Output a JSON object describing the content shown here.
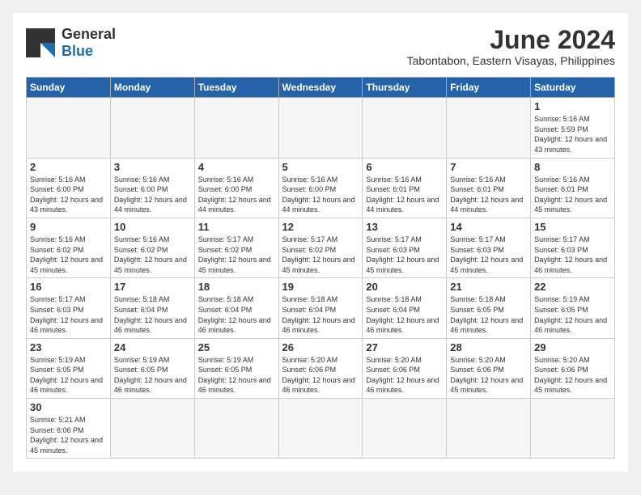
{
  "header": {
    "logo_general": "General",
    "logo_blue": "Blue",
    "month": "June 2024",
    "location": "Tabontabon, Eastern Visayas, Philippines"
  },
  "weekdays": [
    "Sunday",
    "Monday",
    "Tuesday",
    "Wednesday",
    "Thursday",
    "Friday",
    "Saturday"
  ],
  "weeks": [
    [
      {
        "day": "",
        "info": ""
      },
      {
        "day": "",
        "info": ""
      },
      {
        "day": "",
        "info": ""
      },
      {
        "day": "",
        "info": ""
      },
      {
        "day": "",
        "info": ""
      },
      {
        "day": "",
        "info": ""
      },
      {
        "day": "1",
        "info": "Sunrise: 5:16 AM\nSunset: 5:59 PM\nDaylight: 12 hours\nand 43 minutes."
      }
    ],
    [
      {
        "day": "2",
        "info": "Sunrise: 5:16 AM\nSunset: 6:00 PM\nDaylight: 12 hours\nand 43 minutes."
      },
      {
        "day": "3",
        "info": "Sunrise: 5:16 AM\nSunset: 6:00 PM\nDaylight: 12 hours\nand 44 minutes."
      },
      {
        "day": "4",
        "info": "Sunrise: 5:16 AM\nSunset: 6:00 PM\nDaylight: 12 hours\nand 44 minutes."
      },
      {
        "day": "5",
        "info": "Sunrise: 5:16 AM\nSunset: 6:00 PM\nDaylight: 12 hours\nand 44 minutes."
      },
      {
        "day": "6",
        "info": "Sunrise: 5:16 AM\nSunset: 6:01 PM\nDaylight: 12 hours\nand 44 minutes."
      },
      {
        "day": "7",
        "info": "Sunrise: 5:16 AM\nSunset: 6:01 PM\nDaylight: 12 hours\nand 44 minutes."
      },
      {
        "day": "8",
        "info": "Sunrise: 5:16 AM\nSunset: 6:01 PM\nDaylight: 12 hours\nand 45 minutes."
      }
    ],
    [
      {
        "day": "9",
        "info": "Sunrise: 5:16 AM\nSunset: 6:02 PM\nDaylight: 12 hours\nand 45 minutes."
      },
      {
        "day": "10",
        "info": "Sunrise: 5:16 AM\nSunset: 6:02 PM\nDaylight: 12 hours\nand 45 minutes."
      },
      {
        "day": "11",
        "info": "Sunrise: 5:17 AM\nSunset: 6:02 PM\nDaylight: 12 hours\nand 45 minutes."
      },
      {
        "day": "12",
        "info": "Sunrise: 5:17 AM\nSunset: 6:02 PM\nDaylight: 12 hours\nand 45 minutes."
      },
      {
        "day": "13",
        "info": "Sunrise: 5:17 AM\nSunset: 6:03 PM\nDaylight: 12 hours\nand 45 minutes."
      },
      {
        "day": "14",
        "info": "Sunrise: 5:17 AM\nSunset: 6:03 PM\nDaylight: 12 hours\nand 45 minutes."
      },
      {
        "day": "15",
        "info": "Sunrise: 5:17 AM\nSunset: 6:03 PM\nDaylight: 12 hours\nand 46 minutes."
      }
    ],
    [
      {
        "day": "16",
        "info": "Sunrise: 5:17 AM\nSunset: 6:03 PM\nDaylight: 12 hours\nand 46 minutes."
      },
      {
        "day": "17",
        "info": "Sunrise: 5:18 AM\nSunset: 6:04 PM\nDaylight: 12 hours\nand 46 minutes."
      },
      {
        "day": "18",
        "info": "Sunrise: 5:18 AM\nSunset: 6:04 PM\nDaylight: 12 hours\nand 46 minutes."
      },
      {
        "day": "19",
        "info": "Sunrise: 5:18 AM\nSunset: 6:04 PM\nDaylight: 12 hours\nand 46 minutes."
      },
      {
        "day": "20",
        "info": "Sunrise: 5:18 AM\nSunset: 6:04 PM\nDaylight: 12 hours\nand 46 minutes."
      },
      {
        "day": "21",
        "info": "Sunrise: 5:18 AM\nSunset: 6:05 PM\nDaylight: 12 hours\nand 46 minutes."
      },
      {
        "day": "22",
        "info": "Sunrise: 5:19 AM\nSunset: 6:05 PM\nDaylight: 12 hours\nand 46 minutes."
      }
    ],
    [
      {
        "day": "23",
        "info": "Sunrise: 5:19 AM\nSunset: 6:05 PM\nDaylight: 12 hours\nand 46 minutes."
      },
      {
        "day": "24",
        "info": "Sunrise: 5:19 AM\nSunset: 6:05 PM\nDaylight: 12 hours\nand 46 minutes."
      },
      {
        "day": "25",
        "info": "Sunrise: 5:19 AM\nSunset: 6:05 PM\nDaylight: 12 hours\nand 46 minutes."
      },
      {
        "day": "26",
        "info": "Sunrise: 5:20 AM\nSunset: 6:06 PM\nDaylight: 12 hours\nand 46 minutes."
      },
      {
        "day": "27",
        "info": "Sunrise: 5:20 AM\nSunset: 6:06 PM\nDaylight: 12 hours\nand 46 minutes."
      },
      {
        "day": "28",
        "info": "Sunrise: 5:20 AM\nSunset: 6:06 PM\nDaylight: 12 hours\nand 45 minutes."
      },
      {
        "day": "29",
        "info": "Sunrise: 5:20 AM\nSunset: 6:06 PM\nDaylight: 12 hours\nand 45 minutes."
      }
    ],
    [
      {
        "day": "30",
        "info": "Sunrise: 5:21 AM\nSunset: 6:06 PM\nDaylight: 12 hours\nand 45 minutes."
      },
      {
        "day": "",
        "info": ""
      },
      {
        "day": "",
        "info": ""
      },
      {
        "day": "",
        "info": ""
      },
      {
        "day": "",
        "info": ""
      },
      {
        "day": "",
        "info": ""
      },
      {
        "day": "",
        "info": ""
      }
    ]
  ]
}
